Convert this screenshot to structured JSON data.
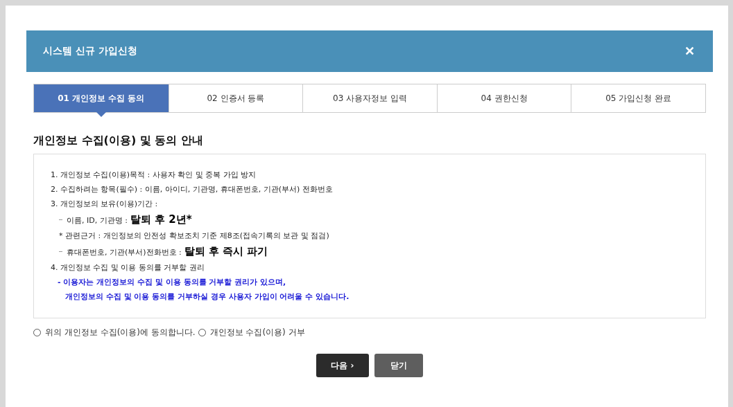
{
  "dialog": {
    "title": "시스템 신규 가입신청",
    "close": "✕"
  },
  "steps": [
    {
      "label": "01 개인정보 수집 동의",
      "selected": true
    },
    {
      "label": "02 인증서 등록",
      "selected": false
    },
    {
      "label": "03 사용자정보 입력",
      "selected": false
    },
    {
      "label": "04 권한신청",
      "selected": false
    },
    {
      "label": "05 가입신청 완료",
      "selected": false
    }
  ],
  "heading": "개인정보 수집(이용) 및 동의 안내",
  "lines": [
    {
      "kind": "item",
      "text": "1. 개인정보 수집(이용)목적 : 사용자 확인 및 중복 가입 방지"
    },
    {
      "kind": "item",
      "text": "2. 수집하려는 항목(필수) : 이름, 아이디, 기관명, 휴대폰번호, 기관(부서) 전화번호"
    },
    {
      "kind": "item",
      "text": "3. 개인정보의 보유(이용)기간 :"
    },
    {
      "kind": "sub",
      "text": "이름, ID, 기관명 :",
      "value": "탈퇴 후 2년*"
    },
    {
      "kind": "note",
      "text": "* 관련근거 : 개인정보의 안전성 확보조치 기준 제8조(접속기록의 보관 및 점검)"
    },
    {
      "kind": "sub",
      "text": "휴대폰번호, 기관(부서)전화번호 :",
      "value": "탈퇴 후 즉시 파기"
    },
    {
      "kind": "item",
      "text": "4. 개인정보 수집 및 이용 동의를 거부할 권리"
    },
    {
      "kind": "warn",
      "text": "- 이용자는 개인정보의 수집 및 이용 동의를 거부할 권리가 있으며,"
    },
    {
      "kind": "warn2",
      "text": "개인정보의 수집 및 이용 동의를 거부하실 경우 사용자 가입이 어려울 수 있습니다."
    }
  ],
  "options": [
    {
      "label": "위의 개인정보 수집(이용)에 동의합니다.",
      "selected": false
    },
    {
      "label": "개인정보 수집(이용) 거부",
      "selected": false
    }
  ],
  "buttons": [
    {
      "kind": "primary",
      "label": "다음 ›"
    },
    {
      "kind": "secondary",
      "label": "닫기"
    }
  ]
}
